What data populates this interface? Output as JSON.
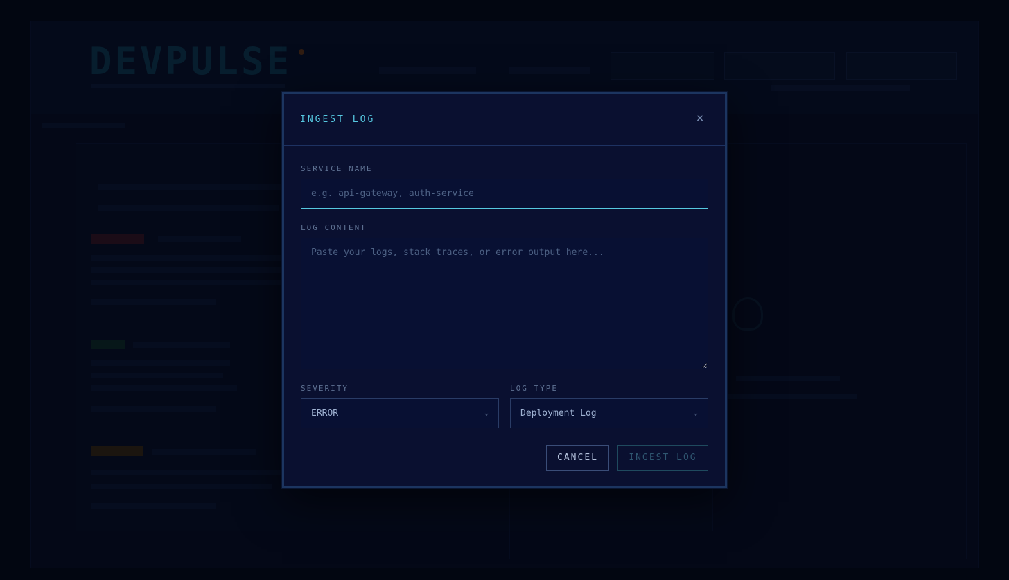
{
  "modal": {
    "title": "INGEST LOG",
    "close_glyph": "×",
    "service_name": {
      "label": "SERVICE NAME",
      "placeholder": "e.g. api-gateway, auth-service",
      "value": ""
    },
    "log_content": {
      "label": "LOG CONTENT",
      "placeholder": "Paste your logs, stack traces, or error output here...",
      "value": ""
    },
    "severity": {
      "label": "SEVERITY",
      "selected": "ERROR"
    },
    "log_type": {
      "label": "LOG TYPE",
      "selected": "Deployment Log"
    },
    "buttons": {
      "cancel": "CANCEL",
      "ingest": "INGEST LOG"
    }
  },
  "colors": {
    "accent": "#56c8e0",
    "modal_bg": "#0a1030",
    "border": "#2a3c66",
    "backdrop": "#040816"
  },
  "icons": {
    "close": "close-icon",
    "chevron": "chevron-down-icon"
  }
}
